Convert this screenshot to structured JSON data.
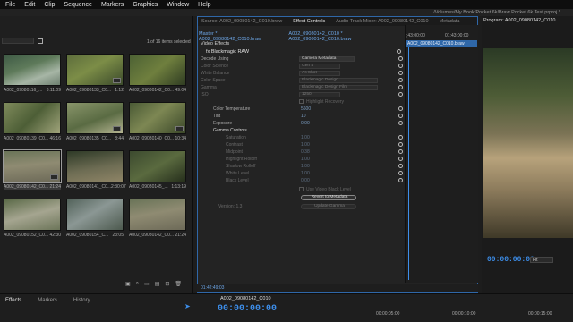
{
  "menu": [
    "File",
    "Edit",
    "Clip",
    "Sequence",
    "Markers",
    "Graphics",
    "Window",
    "Help"
  ],
  "path": "/Volumes/My Book/Pocket 6k/Braw Pocket 6k Test.prproj *",
  "project": {
    "items_selected": "1 of 16 items selected"
  },
  "thumbs": [
    {
      "name": "A002_09080116_...",
      "dur": "3:11:09"
    },
    {
      "name": "A002_09080133_C0...",
      "dur": "1:12"
    },
    {
      "name": "A002_09080142_C0...",
      "dur": "49:04"
    },
    {
      "name": "A002_09080139_C0...",
      "dur": "46:16"
    },
    {
      "name": "A002_09080135_C0...",
      "dur": "8:44"
    },
    {
      "name": "A002_09080140_C0...",
      "dur": "10:34"
    },
    {
      "name": "A002_09080142_C0...",
      "dur": "21:24"
    },
    {
      "name": "A002_09080141_C0...",
      "dur": "2:30:07"
    },
    {
      "name": "A002_09080145_...",
      "dur": "1:13:19"
    },
    {
      "name": "A002_09080152_C0...",
      "dur": "42:30"
    },
    {
      "name": "A002_09080154_C...",
      "dur": "23:05"
    },
    {
      "name": "A002_09080142_C0...",
      "dur": "21:24"
    }
  ],
  "effect_panel": {
    "tabs": [
      "Source: A002_09080142_C010.braw",
      "Effect Controls",
      "Audio Track Mixer: A002_09080142_C010",
      "Metadata"
    ],
    "master": "Master * A002_09080142_C010.braw",
    "sequence": "A002_09080142_C010 * A002_09080142_C010.braw",
    "video_effects": "Video Effects",
    "effect": "Blackmagic RAW",
    "tc_in": ";43:00:00",
    "tc_out": "01:43:00:00",
    "clip_label": "A002_09080142_C010.braw",
    "rows": [
      {
        "n": "Decode Using",
        "v": "Camera Metadata"
      },
      {
        "n": "Color Science",
        "v": "Gen 4"
      },
      {
        "n": "White Balance",
        "v": "As Shot"
      },
      {
        "n": "Color Space",
        "v": "Blackmagic Design"
      },
      {
        "n": "Gamma",
        "v": "Blackmagic Design Film"
      },
      {
        "n": "ISO",
        "v": "1250"
      },
      {
        "n": "",
        "v": "Highlight Recovery"
      },
      {
        "n": "Color Temperature",
        "v": "5600"
      },
      {
        "n": "Tint",
        "v": "10"
      },
      {
        "n": "Exposure",
        "v": "0.00"
      },
      {
        "n": "Gamma Controls",
        "v": ""
      },
      {
        "n": "Saturation",
        "v": "1.00"
      },
      {
        "n": "Contrast",
        "v": "1.00"
      },
      {
        "n": "Midpoint",
        "v": "0.38"
      },
      {
        "n": "Highlight Rolloff",
        "v": "1.00"
      },
      {
        "n": "Shadow Rolloff",
        "v": "1.00"
      },
      {
        "n": "White Level",
        "v": "1.00"
      },
      {
        "n": "Black Level",
        "v": "0.00"
      },
      {
        "n": "",
        "v": "Use Video Black Level"
      },
      {
        "n": "",
        "v": "Revert to Metadata"
      },
      {
        "n": "Version: 1.3",
        "v": "Update Gamma"
      }
    ],
    "footer_tc": "01:42:49:03"
  },
  "program": {
    "title": "Program: A002_09080142_C010",
    "tc": "00:00:00:00",
    "fit": "Fit"
  },
  "bottom": {
    "tabs": [
      "Effects",
      "Markers",
      "History"
    ],
    "seq_title": "A002_09080142_C010",
    "tc": "00:00:00:00",
    "r1": "00:00:05:00",
    "r2": "00:00:10:00",
    "r3": "00:00:15:00"
  },
  "colors": {
    "accent": "#3d8eea",
    "sel": "#2f67a8"
  }
}
